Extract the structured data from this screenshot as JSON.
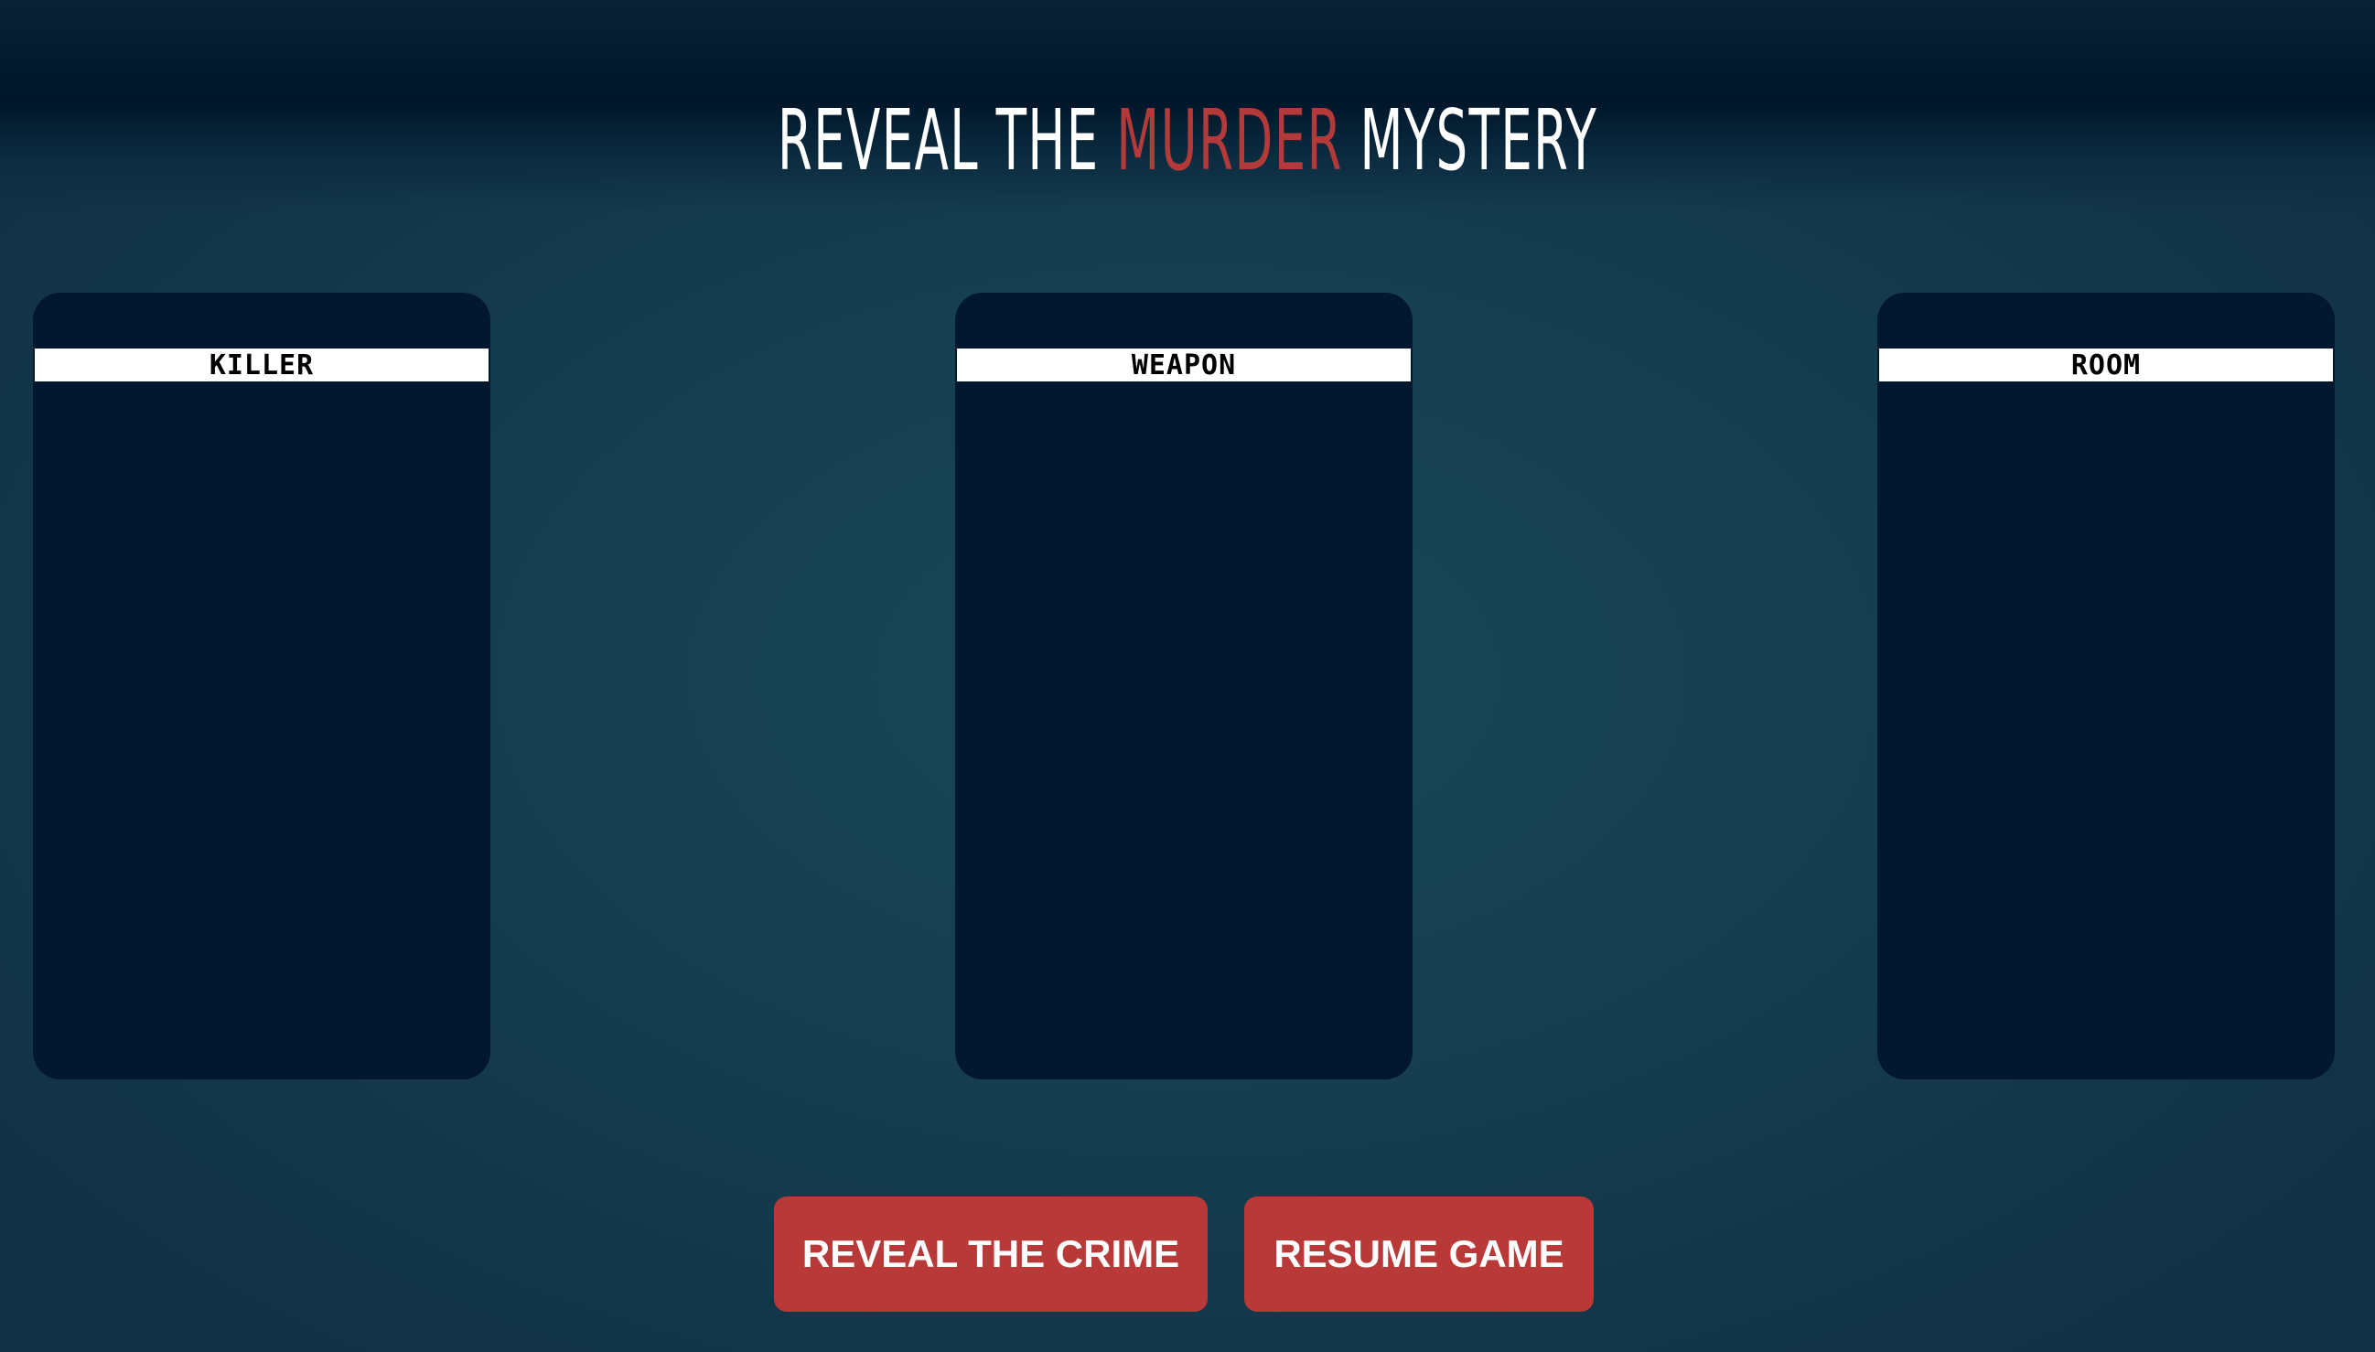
{
  "title": {
    "part1": "REVEAL THE ",
    "accent": "MURDER",
    "part2": " MYSTERY"
  },
  "cards": {
    "killer": {
      "label": "KILLER"
    },
    "weapon": {
      "label": "WEAPON"
    },
    "room": {
      "label": "ROOM"
    }
  },
  "buttons": {
    "reveal_label": "REVEAL THE CRIME",
    "resume_label": "RESUME GAME"
  },
  "colors": {
    "accent": "#b93838",
    "card": "#011830",
    "background": "#184656"
  }
}
